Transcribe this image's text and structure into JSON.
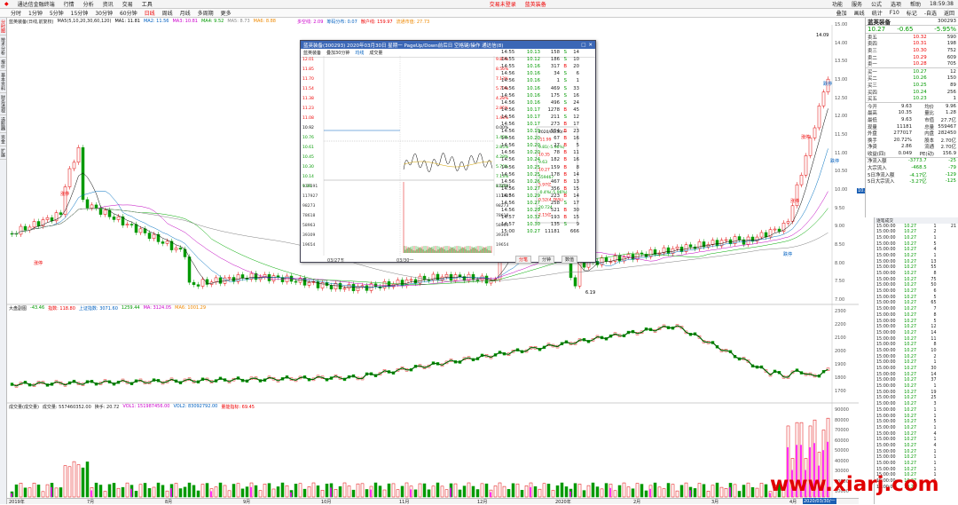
{
  "menubar": {
    "app_title": "通达信金融终端",
    "menus": [
      "行情",
      "分析",
      "资讯",
      "交易",
      "工具"
    ],
    "center": [
      "交易未登录",
      "蓝英装备"
    ],
    "right": [
      "功能",
      "服务",
      "公式",
      "选项",
      "帮助"
    ],
    "time": "18:59:38"
  },
  "periods": [
    "分时",
    "1分钟",
    "5分钟",
    "15分钟",
    "30分钟",
    "60分钟",
    "日线",
    "周线",
    "月线",
    "多周期",
    "更多"
  ],
  "toolbar_right": [
    "叠加",
    "画线",
    "统计",
    "F10",
    "标记",
    "-自选",
    "返回"
  ],
  "leftbar": [
    "分时图",
    "技术分析",
    "报价",
    "基本资料",
    "财务透视",
    "选股器",
    "资金",
    "扩展"
  ],
  "main_info": {
    "name": "蓝英装备(日线,前复权)",
    "ma_label": "MA5(5,10,20,30,60,120)",
    "ma_values": [
      "MA1: 11.81",
      "MA2: 11.56",
      "MA3: 10.81",
      "MA4: 9.52",
      "MA5: 8.73",
      "MA6: 8.88"
    ],
    "extra": [
      "多空线: 2.09",
      "筹码分布: 0.07",
      "散户线: 159.97",
      "流通市值: 27.73"
    ]
  },
  "price_axis": [
    "15.00",
    "14.00",
    "13.50",
    "13.00",
    "12.50",
    "12.00",
    "11.50",
    "11.00",
    "10.50",
    "10.00",
    "9.50",
    "9.00",
    "8.50",
    "8.00",
    "7.50",
    "7.00"
  ],
  "annotations": {
    "high": "14.09",
    "low": "6.19",
    "current_tag": "10.27",
    "labels": [
      "涨停",
      "涨停",
      "涨停",
      "跌停",
      "跌停",
      "跌停",
      "涨停",
      "跌停"
    ]
  },
  "index_panel": {
    "title": "大盘副图",
    "values": [
      "-43.46",
      "指数: 118.80",
      "上证指数: 3071.60",
      "1259.44",
      "MA: 3124.05",
      "MA6: 1001.29"
    ],
    "axis": [
      "2300",
      "2200",
      "2100",
      "2000",
      "1900",
      "1800",
      "1700"
    ]
  },
  "volume_panel": {
    "title": "成交量(成交量)",
    "values": [
      "成交量: 557460352.00",
      "换手: 20.72",
      "VOL1: 151987456.00",
      "VOL2: 83092792.00",
      "量能指标: 69.45"
    ],
    "axis": [
      "90000",
      "80000",
      "70000",
      "60000",
      "50000",
      "40000",
      "30000",
      "20000",
      "10000"
    ]
  },
  "date_axis": [
    "2019年",
    "7月",
    "8月",
    "9月",
    "10月",
    "11月",
    "12月",
    "2020年",
    "2月",
    "3月",
    "4月"
  ],
  "date_current": "2020/03/30/一",
  "quote": {
    "name": "蓝英装备",
    "code": "300293",
    "price": "10.27",
    "change": "-0.65",
    "pct": "-5.95%",
    "sells": [
      [
        "卖五",
        "10.32",
        "590"
      ],
      [
        "卖四",
        "10.31",
        "198"
      ],
      [
        "卖三",
        "10.30",
        "752"
      ],
      [
        "卖二",
        "10.29",
        "609"
      ],
      [
        "卖一",
        "10.28",
        "705"
      ]
    ],
    "buys": [
      [
        "买一",
        "10.27",
        "12"
      ],
      [
        "买二",
        "10.26",
        "150"
      ],
      [
        "买三",
        "10.25",
        "89"
      ],
      [
        "买四",
        "10.24",
        "256"
      ],
      [
        "买五",
        "10.23",
        "1"
      ]
    ],
    "stats": [
      [
        "今开",
        "9.63",
        "均价",
        "9.96"
      ],
      [
        "最高",
        "10.35",
        "量比",
        "1.28"
      ],
      [
        "最低",
        "9.63",
        "市值",
        "27.7亿"
      ],
      [
        "现量",
        "11181",
        "总量",
        "559467"
      ],
      [
        "外盘",
        "277017",
        "内盘",
        "282450"
      ],
      [
        "换手",
        "20.72%",
        "股本",
        "2.70亿"
      ],
      [
        "净资",
        "2.86",
        "流通",
        "2.70亿"
      ],
      [
        "收益(四)",
        "0.049",
        "PE(动)",
        "156.9"
      ]
    ],
    "flows": [
      [
        "净流入额",
        "-3773.7",
        "-25"
      ],
      [
        "大宗流入",
        "-468.5",
        "-79"
      ],
      [
        "5日净流入额",
        "-4.17亿",
        "-129"
      ],
      [
        "5日大宗流入",
        "-3.27亿",
        "-125"
      ]
    ]
  },
  "tick": {
    "title": "逐笔成交",
    "rows": [
      [
        "15:00:00",
        "10.27",
        "1",
        "21"
      ],
      [
        "15:00:00",
        "10.27",
        "2",
        ""
      ],
      [
        "15:00:00",
        "10.27",
        "1",
        ""
      ],
      [
        "15:00:00",
        "10.27",
        "5",
        ""
      ],
      [
        "15:00:00",
        "10.27",
        "4",
        ""
      ],
      [
        "15:00:00",
        "10.27",
        "1",
        ""
      ],
      [
        "15:00:00",
        "10.27",
        "13",
        ""
      ],
      [
        "15:00:00",
        "10.27",
        "55",
        ""
      ],
      [
        "15:00:00",
        "10.27",
        "8",
        ""
      ],
      [
        "15:00:00",
        "10.27",
        "75",
        ""
      ],
      [
        "15:00:00",
        "10.27",
        "50",
        ""
      ],
      [
        "15:00:00",
        "10.27",
        "6",
        ""
      ],
      [
        "15:00:00",
        "10.27",
        "5",
        ""
      ],
      [
        "15:00:00",
        "10.27",
        "65",
        ""
      ],
      [
        "15:00:00",
        "10.27",
        "7",
        ""
      ],
      [
        "15:00:00",
        "10.27",
        "8",
        ""
      ],
      [
        "15:00:00",
        "10.27",
        "5",
        ""
      ],
      [
        "15:00:00",
        "10.27",
        "12",
        ""
      ],
      [
        "15:00:00",
        "10.27",
        "14",
        ""
      ],
      [
        "15:00:00",
        "10.27",
        "11",
        ""
      ],
      [
        "15:00:00",
        "10.27",
        "8",
        ""
      ],
      [
        "15:00:00",
        "10.27",
        "10",
        ""
      ],
      [
        "15:00:00",
        "10.27",
        "2",
        ""
      ],
      [
        "15:00:00",
        "10.27",
        "1",
        ""
      ],
      [
        "15:00:00",
        "10.27",
        "30",
        ""
      ],
      [
        "15:00:00",
        "10.27",
        "14",
        ""
      ],
      [
        "15:00:00",
        "10.27",
        "37",
        ""
      ],
      [
        "15:00:00",
        "10.27",
        "1",
        ""
      ],
      [
        "15:00:00",
        "10.27",
        "19",
        ""
      ],
      [
        "15:00:00",
        "10.27",
        "25",
        ""
      ],
      [
        "15:00:00",
        "10.27",
        "3",
        ""
      ],
      [
        "15:00:00",
        "10.27",
        "1",
        ""
      ],
      [
        "15:00:00",
        "10.27",
        "1",
        ""
      ],
      [
        "15:00:00",
        "10.27",
        "5",
        ""
      ],
      [
        "15:00:00",
        "10.27",
        "1",
        ""
      ],
      [
        "15:00:00",
        "10.27",
        "4",
        ""
      ],
      [
        "15:00:00",
        "10.27",
        "1",
        ""
      ],
      [
        "15:00:00",
        "10.27",
        "4",
        ""
      ],
      [
        "15:00:00",
        "10.27",
        "1",
        ""
      ],
      [
        "15:00:00",
        "10.27",
        "1",
        ""
      ],
      [
        "15:00:00",
        "10.27",
        "1",
        ""
      ],
      [
        "15:00:00",
        "10.27",
        "1",
        ""
      ],
      [
        "15:00:00",
        "10.27",
        "1",
        ""
      ],
      [
        "15:00:00",
        "10.27",
        "1",
        ""
      ],
      [
        "15:00:00",
        "10.27",
        "1",
        ""
      ]
    ]
  },
  "popup": {
    "title": "蓝英装备(300293) 2020年03月30日 星期一 PageUp/Down前后日 空格键/操作 通达信(8)",
    "tabs": [
      "蓝英装备",
      "叠加30分钟",
      "均线",
      "成交量"
    ],
    "price_axis": [
      "12.01",
      "11.85",
      "11.70",
      "11.54",
      "11.38",
      "11.23",
      "11.08",
      "10.92",
      "10.76",
      "10.61",
      "10.45",
      "10.30",
      "10.14",
      "9.99"
    ],
    "pct_axis": [
      "9.86%",
      "8.56%",
      "7.13%",
      "5.70%",
      "4.28%",
      "2.85%",
      "1.43%",
      "0.00%",
      "1.43%",
      "2.85%",
      "4.28%",
      "5.70%",
      "7.13%",
      "8.56%"
    ],
    "vol_axis": [
      "137591",
      "117927",
      "98273",
      "78618",
      "58963",
      "39309",
      "19654"
    ],
    "time_axis": [
      "03/27五",
      "03/30一"
    ],
    "mini_info": [
      "2020/03/30/一",
      "-11.99",
      "9.81(-5.96%)",
      "10.35",
      "9.63",
      "10.27",
      "559467",
      "5.97亿",
      "-0.4%(-5.96%)",
      "0.52(4.76%)",
      "20.724",
      "2.15亿"
    ],
    "ticks": [
      [
        "14:55",
        "10.13",
        "158",
        "S",
        "14"
      ],
      [
        "14:55",
        "10.12",
        "186",
        "S",
        "10"
      ],
      [
        "14:55",
        "10.16",
        "317",
        "B",
        "20"
      ],
      [
        "14:56",
        "10.16",
        "34",
        "S",
        "6"
      ],
      [
        "14:56",
        "10.16",
        "1",
        "S",
        "1"
      ],
      [
        "14:56",
        "10.16",
        "469",
        "S",
        "33"
      ],
      [
        "14:56",
        "10.16",
        "175",
        "S",
        "16"
      ],
      [
        "14:56",
        "10.16",
        "496",
        "S",
        "24"
      ],
      [
        "14:56",
        "10.17",
        "1278",
        "B",
        "45"
      ],
      [
        "14:56",
        "10.17",
        "211",
        "S",
        "12"
      ],
      [
        "14:56",
        "10.17",
        "273",
        "B",
        "17"
      ],
      [
        "14:56",
        "10.19",
        "554",
        "B",
        "23"
      ],
      [
        "14:56",
        "10.20",
        "67",
        "B",
        "16"
      ],
      [
        "14:56",
        "10.20",
        "27",
        "B",
        "5"
      ],
      [
        "14:56",
        "10.20",
        "78",
        "B",
        "11"
      ],
      [
        "14:56",
        "10.24",
        "182",
        "B",
        "16"
      ],
      [
        "14:56",
        "10.25",
        "159",
        "B",
        "8"
      ],
      [
        "14:56",
        "10.25",
        "178",
        "B",
        "14"
      ],
      [
        "14:56",
        "10.26",
        "467",
        "B",
        "13"
      ],
      [
        "14:56",
        "10.27",
        "356",
        "B",
        "15"
      ],
      [
        "14:56",
        "10.29",
        "223",
        "B",
        "14"
      ],
      [
        "14:56",
        "10.27",
        "258",
        "S",
        "17"
      ],
      [
        "14:56",
        "10.29",
        "521",
        "B",
        "30"
      ],
      [
        "14:57",
        "10.32",
        "193",
        "B",
        "15"
      ],
      [
        "14:57",
        "10.30",
        "135",
        "S",
        "9"
      ],
      [
        "15:00",
        "10.27",
        "11181",
        "",
        "666"
      ]
    ],
    "buttons": [
      "分笔",
      "分钟",
      "数值"
    ]
  },
  "watermark": "www.xiarj.com",
  "colors": {
    "up": "#e00000",
    "down": "#009900",
    "ma1": "#000000",
    "ma2": "#0070c0",
    "ma3": "#c000c0",
    "ma4": "#00aa00",
    "ma5": "#808080"
  }
}
